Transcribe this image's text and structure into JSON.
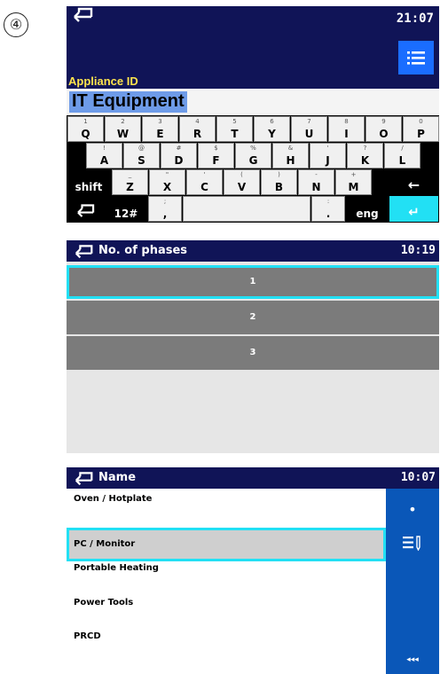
{
  "step_marker": "④",
  "keyboard_screen": {
    "time": "21:07",
    "menu_icon": "list-menu-icon",
    "back_icon": "back-arrow-icon",
    "field_label": "Appliance ID",
    "field_value": "IT Equipment",
    "rows": [
      [
        {
          "sub": "1",
          "main": "Q"
        },
        {
          "sub": "2",
          "main": "W"
        },
        {
          "sub": "3",
          "main": "E"
        },
        {
          "sub": "4",
          "main": "R"
        },
        {
          "sub": "5",
          "main": "T"
        },
        {
          "sub": "6",
          "main": "Y"
        },
        {
          "sub": "7",
          "main": "U"
        },
        {
          "sub": "8",
          "main": "I"
        },
        {
          "sub": "9",
          "main": "O"
        },
        {
          "sub": "0",
          "main": "P"
        }
      ],
      [
        {
          "sub": "!",
          "main": "A"
        },
        {
          "sub": "@",
          "main": "S"
        },
        {
          "sub": "#",
          "main": "D"
        },
        {
          "sub": "$",
          "main": "F"
        },
        {
          "sub": "%",
          "main": "G"
        },
        {
          "sub": "&",
          "main": "H"
        },
        {
          "sub": "'",
          "main": "J"
        },
        {
          "sub": "?",
          "main": "K"
        },
        {
          "sub": "/",
          "main": "L"
        }
      ],
      [
        {
          "sub": "_",
          "main": "Z"
        },
        {
          "sub": "\"",
          "main": "X"
        },
        {
          "sub": "'",
          "main": "C"
        },
        {
          "sub": "(",
          "main": "V"
        },
        {
          "sub": ")",
          "main": "B"
        },
        {
          "sub": "-",
          "main": "N"
        },
        {
          "sub": "+",
          "main": "M"
        }
      ]
    ],
    "shift_label": "shift",
    "backspace_label": "←",
    "symbols_label": "12#",
    "comma_sub": ";",
    "comma_main": ",",
    "period_sub": ":",
    "period_main": ".",
    "lang_label": "eng",
    "enter_label": "↵",
    "back_key_label": "⮌"
  },
  "phases_screen": {
    "title": "No. of phases",
    "time": "10:19",
    "options": [
      "1",
      "2",
      "3"
    ],
    "selected_index": 0
  },
  "name_screen": {
    "title": "Name",
    "time": "10:07",
    "items": [
      "Oven / Hotplate",
      "PC / Monitor",
      "Portable Heating",
      "Power Tools",
      "PRCD"
    ],
    "selected_index": 1,
    "side_buttons": {
      "dot": "•",
      "edit_icon": "list-edit-icon",
      "page_label": "◂◂◂"
    }
  },
  "colors": {
    "header_navy": "#101457",
    "accent_blue": "#1a6dff",
    "cyan_highlight": "#22e0f4",
    "label_yellow": "#ffe44d",
    "side_panel_blue": "#0a57b8"
  }
}
